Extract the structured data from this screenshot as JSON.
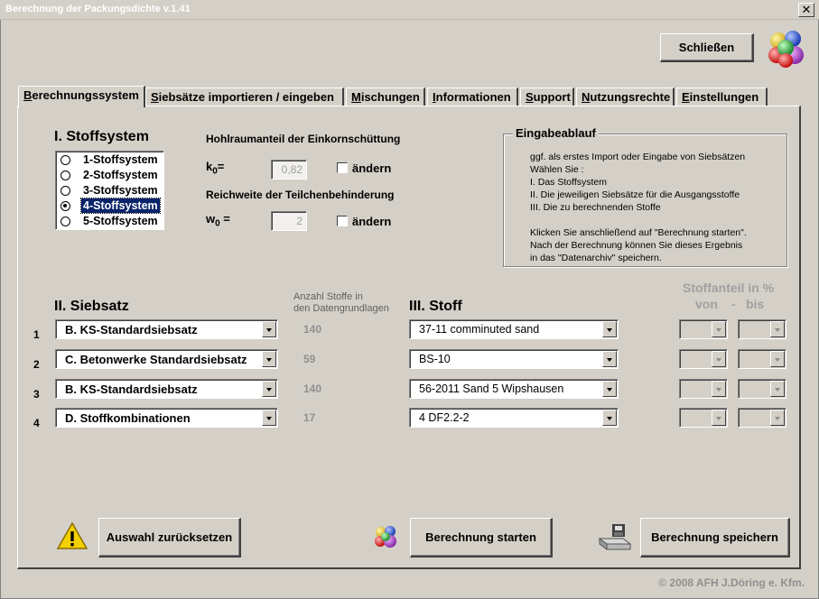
{
  "window": {
    "title": "Berechnung der Packungsdichte v.1.41",
    "close_glyph": "✕"
  },
  "header": {
    "close_button": "Schließen"
  },
  "tabs": [
    {
      "pre": "",
      "u": "B",
      "post": "erechnungssystem"
    },
    {
      "pre": "",
      "u": "S",
      "post": "iebsätze importieren / eingeben"
    },
    {
      "pre": "",
      "u": "M",
      "post": "ischungen"
    },
    {
      "pre": "",
      "u": "I",
      "post": "nformationen"
    },
    {
      "pre": "",
      "u": "S",
      "post": "upport"
    },
    {
      "pre": "",
      "u": "N",
      "post": "utzungsrechte"
    },
    {
      "pre": "",
      "u": "E",
      "post": "instellungen"
    }
  ],
  "stoffsystem": {
    "heading": "I. Stoffsystem",
    "options": [
      "1-Stoffsystem",
      "2-Stoffsystem",
      "3-Stoffsystem",
      "4-Stoffsystem",
      "5-Stoffsystem"
    ],
    "selected": "4-Stoffsystem"
  },
  "params": {
    "hohlraum_label": "Hohlraumanteil der Einkornschüttung",
    "k0_main": "k",
    "k0_sub": "0",
    "k0_eq": "=",
    "k0_value": "0,82",
    "k0_change": "ändern",
    "reichweite_label": "Reichweite der Teilchenbehinderung",
    "w0_main": "w",
    "w0_sub": "0",
    "w0_eq": " =",
    "w0_value": "2",
    "w0_change": "ändern"
  },
  "eingabeablauf": {
    "title": "Eingabeablauf",
    "lines": [
      "ggf. als erstes Import oder Eingabe von Siebsätzen",
      "Wählen Sie :",
      "I. Das Stoffsystem",
      "II. Die jeweiligen Siebsätze für die Ausgangsstoffe",
      "III. Die zu berechnenden Stoffe",
      "Klicken Sie anschließend auf \"Berechnung starten\".",
      "Nach der Berechnung können Sie dieses Ergebnis",
      "in das \"Datenarchiv\" speichern."
    ]
  },
  "siebsatz": {
    "heading": "II. Siebsatz",
    "count_heading_1": "Anzahl Stoffe in",
    "count_heading_2": "den Datengrundlagen",
    "stoff_heading": "III. Stoff",
    "anteil_heading": "Stoffanteil in %",
    "von": "von",
    "dash": "-",
    "bis": "bis",
    "rows": [
      {
        "num": "1",
        "siebsatz": "B. KS-Standardsiebsatz",
        "count": "140",
        "stoff": "37-11 comminuted sand"
      },
      {
        "num": "2",
        "siebsatz": "C. Betonwerke Standardsiebsatz",
        "count": "59",
        "stoff": "BS-10"
      },
      {
        "num": "3",
        "siebsatz": "B. KS-Standardsiebsatz",
        "count": "140",
        "stoff": "56-2011 Sand 5 Wipshausen"
      },
      {
        "num": "4",
        "siebsatz": "D. Stoffkombinationen",
        "count": "17",
        "stoff": "4 DF2.2-2"
      }
    ]
  },
  "buttons": {
    "reset": "Auswahl zurücksetzen",
    "start": "Berechnung starten",
    "save": "Berechnung speichern"
  },
  "footer": "© 2008  AFH J.Döring e. Kfm."
}
